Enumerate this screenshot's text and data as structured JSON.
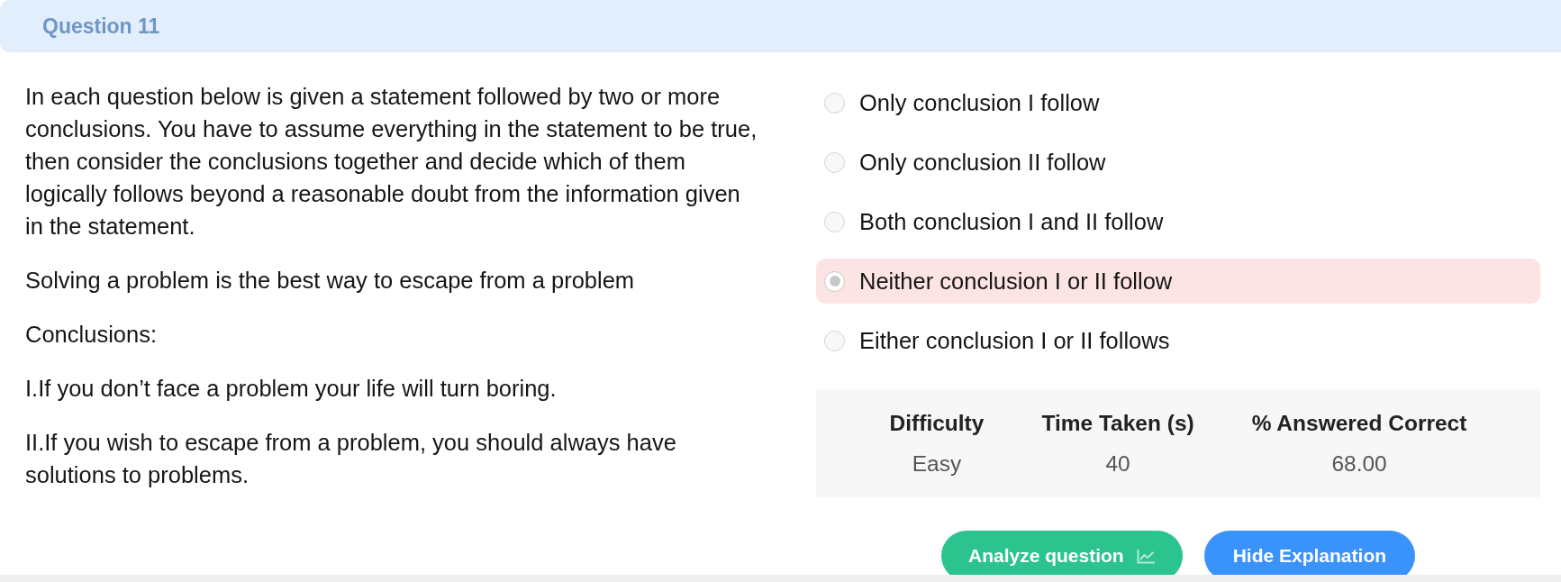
{
  "header": {
    "title": "Question 11"
  },
  "question": {
    "instructions": "In each question below is given a statement followed by two or more conclusions. You have to assume everything in the statement to be true, then consider the conclusions together and decide which of them logically follows beyond a reasonable doubt from the information given in the statement.",
    "statement": "Solving a problem is the best way to escape from a problem",
    "conclusions_label": "Conclusions:",
    "conclusions": [
      "I.If you don’t face a problem your life will turn boring.",
      "II.If you wish to escape from a problem, you should always have solutions to problems."
    ]
  },
  "options": [
    {
      "label": "Only conclusion I follow",
      "selected": false
    },
    {
      "label": "Only conclusion II follow",
      "selected": false
    },
    {
      "label": "Both conclusion I and II follow",
      "selected": false
    },
    {
      "label": "Neither conclusion I or II follow",
      "selected": true
    },
    {
      "label": "Either conclusion I or II follows",
      "selected": false
    }
  ],
  "stats": {
    "columns": [
      "Difficulty",
      "Time Taken (s)",
      "% Answered Correct"
    ],
    "rows": [
      [
        "Easy",
        "40",
        "68.00"
      ]
    ]
  },
  "buttons": [
    {
      "label": "Analyze question",
      "kind": "analyze"
    },
    {
      "label": "Hide Explanation",
      "kind": "explanation"
    }
  ]
}
